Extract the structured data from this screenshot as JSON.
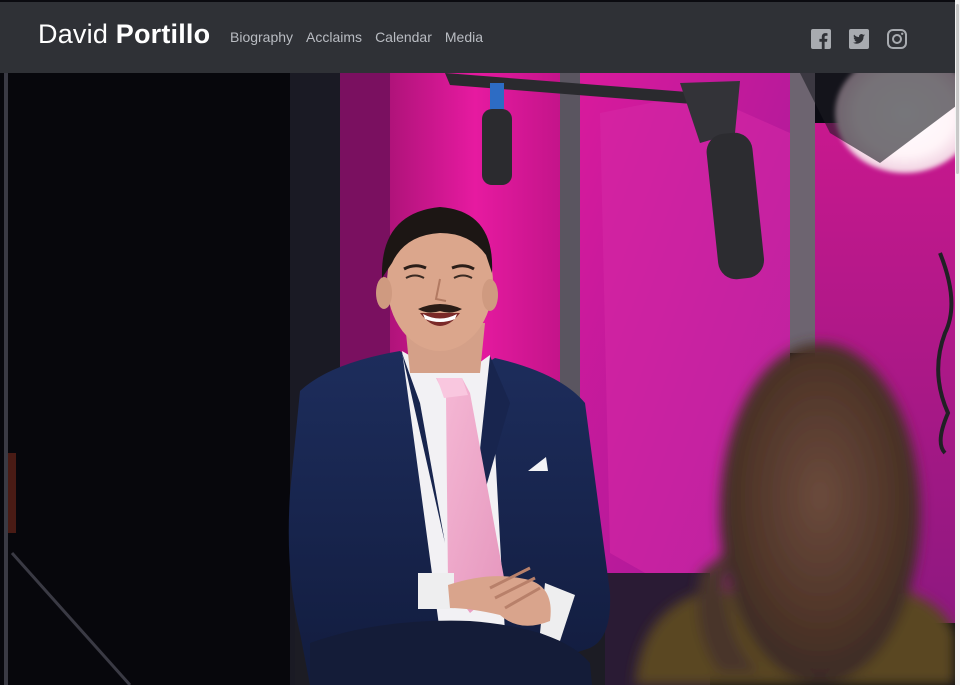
{
  "brand": {
    "first": "David",
    "last": "Portillo"
  },
  "nav": {
    "items": [
      "Biography",
      "Acclaims",
      "Calendar",
      "Media"
    ]
  },
  "social": {
    "icons": [
      "facebook-icon",
      "twitter-icon",
      "instagram-icon"
    ]
  },
  "colors": {
    "navbar": "#2f3136",
    "brand": "#ffffff",
    "nav_link": "#b9bcc2",
    "icon": "#a8abb0",
    "backdrop_magenta": "#e0189a"
  }
}
